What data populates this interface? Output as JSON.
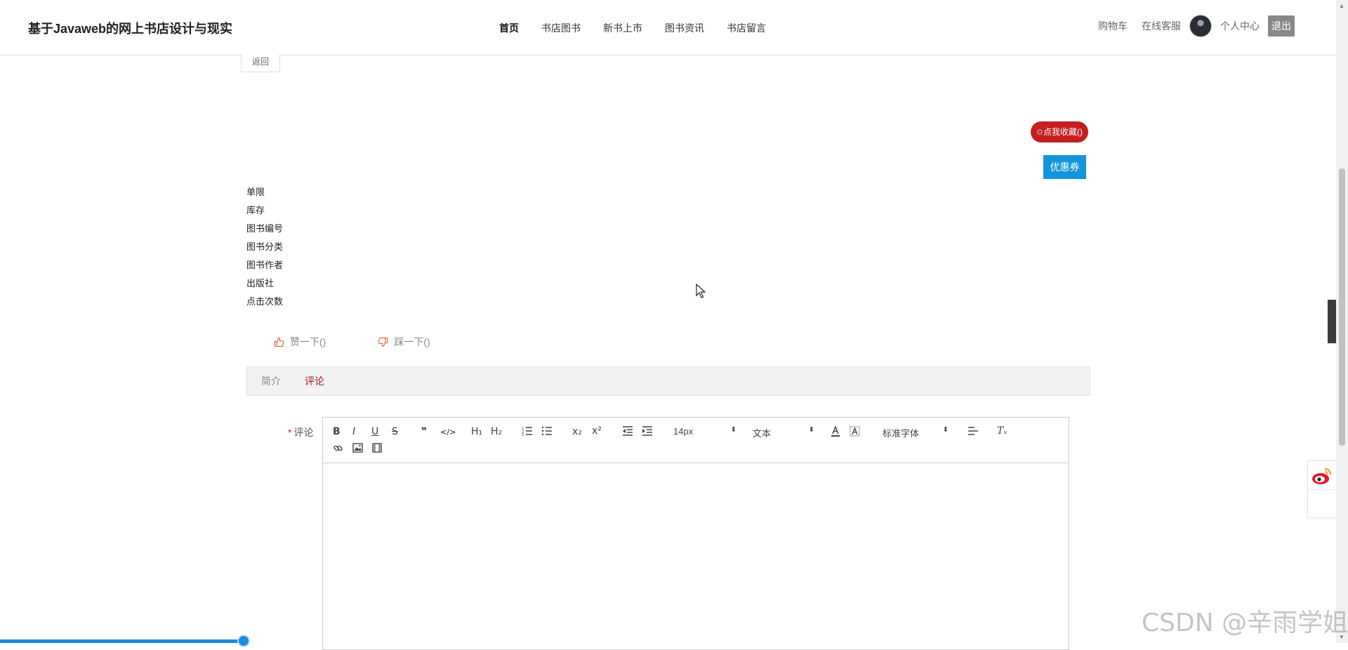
{
  "header": {
    "site_title": "基于Javaweb的网上书店设计与现实",
    "nav": [
      "首页",
      "书店图书",
      "新书上市",
      "图书资讯",
      "书店留言"
    ],
    "active_nav": "首页",
    "user_links": {
      "cart": "购物车",
      "service": "在线客服",
      "profile": "个人中心",
      "logout": "退出"
    }
  },
  "detail": {
    "back_label": "返回",
    "favorite_label": "✩点我收藏()",
    "coupon_label": "优惠券",
    "info_fields": [
      "单限",
      "库存",
      "图书编号",
      "图书分类",
      "图书作者",
      "出版社",
      "点击次数"
    ],
    "like_label": "赞一下()",
    "dislike_label": "踩一下()"
  },
  "tabs": {
    "items": [
      "简介",
      "评论"
    ],
    "active": "评论"
  },
  "comment": {
    "required_mark": "*",
    "label": "评论",
    "toolbar": {
      "bold": "B",
      "italic": "I",
      "underline": "U",
      "strike": "S",
      "blockquote": "❞",
      "code": "</>",
      "h1": "H₁",
      "h2": "H₂",
      "subscript": "x₂",
      "superscript": "x²",
      "size_value": "14px",
      "header_value": "文本",
      "font_value": "标准字体",
      "clear": "Tₓ",
      "select_arrow": "⬍"
    }
  },
  "side": {
    "toggle_icon": "‹",
    "scroll_up": "▲",
    "scroll_down": "▼"
  },
  "watermark": "CSDN @辛雨学姐",
  "colors": {
    "favorite": "#c41f1f",
    "coupon": "#1296db",
    "active_tab": "#a31515",
    "logout_bg": "#888888"
  }
}
